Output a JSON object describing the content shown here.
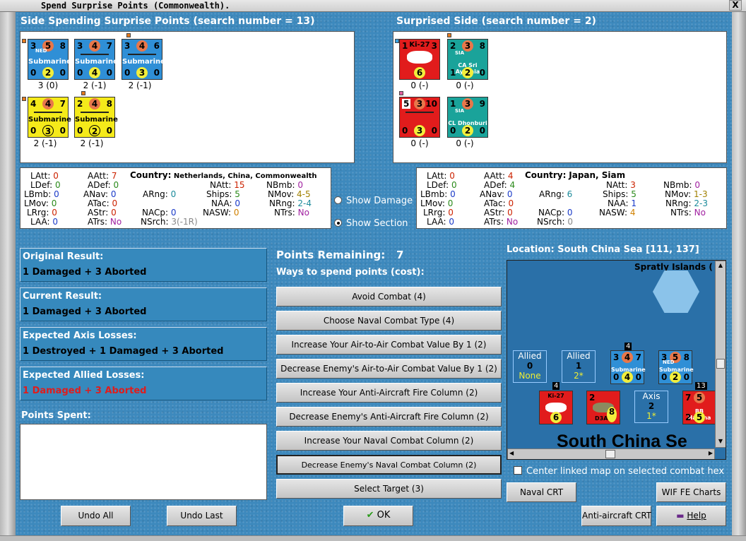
{
  "window": {
    "title": "Spend Surprise Points (Commonwealth).",
    "close": "X"
  },
  "left_side": {
    "header": "Side Spending Surprise Points (search number = 13)",
    "counters": [
      {
        "tl": "3",
        "tm": "5",
        "tr": "8",
        "nat": "NED",
        "name": "Submarine",
        "bl": "0",
        "bm": "2",
        "br": "0",
        "cap": "3 (0)"
      },
      {
        "tl": "3",
        "tm": "4",
        "tr": "7",
        "nat": "",
        "name": "Submarine",
        "bl": "0",
        "bm": "4",
        "br": "0",
        "cap": "2 (-1)"
      },
      {
        "tl": "3",
        "tm": "4",
        "tr": "6",
        "nat": "",
        "name": "Submarine",
        "bl": "0",
        "bm": "3",
        "br": "0",
        "cap": "2 (-1)"
      },
      {
        "tl": "4",
        "tm": "4",
        "tr": "7",
        "nat": "",
        "name": "Submarine",
        "bl": "0",
        "bm": "3",
        "br": "0",
        "cap": "2 (-1)"
      },
      {
        "tl": "2",
        "tm": "4",
        "tr": "8",
        "nat": "",
        "name": "Submarine",
        "bl": "0",
        "bm": "2",
        "br": "0",
        "cap": "2 (-1)"
      }
    ],
    "stats": {
      "LAtt": "0",
      "LDef": "0",
      "LBmb": "0",
      "LMov": "0",
      "LRrg": "0",
      "LAA": "0",
      "AAtt": "7",
      "ADef": "0",
      "ANav": "0",
      "ATac": "0",
      "AStr": "0",
      "ATrs": "No",
      "country_label": "Country:",
      "country": "Netherlands, China, Commonwealth",
      "ARng": "0",
      "NACp": "0",
      "NSrch": "3(-1R)",
      "NAtt": "15",
      "Ships": "5",
      "NAA": "0",
      "NASW": "0",
      "NBmb": "0",
      "NMov": "4-5",
      "NRng": "2-4",
      "NTrs": "No"
    }
  },
  "right_side": {
    "header": "Surprised Side (search number = 2)",
    "counters": [
      {
        "tl": "1",
        "tm": "",
        "tr": "3",
        "nat": "",
        "name": "Ki-27",
        "bl": "",
        "bm": "6",
        "br": "",
        "cap": "0 (-)"
      },
      {
        "tl": "2",
        "tm": "3",
        "tr": "8",
        "nat": "SIA",
        "name": "CA Sri Ayuthia",
        "bl": "1",
        "bm": "2",
        "br": "0",
        "cap": "0 (-)"
      },
      {
        "tl": "5",
        "tm": "3",
        "tr": "10",
        "nat": "",
        "name": "",
        "bl": "0",
        "bm": "3",
        "br": "0",
        "cap": "0 (-)"
      },
      {
        "tl": "1",
        "tm": "3",
        "tr": "9",
        "nat": "SIA",
        "name": "CL Dhonburi",
        "bl": "0",
        "bm": "2",
        "br": "0",
        "cap": "0 (-)"
      }
    ],
    "stats": {
      "LAtt": "0",
      "LDef": "0",
      "LBmb": "0",
      "LMov": "0",
      "LRrg": "0",
      "LAA": "0",
      "AAtt": "4",
      "ADef": "4",
      "ANav": "0",
      "ATac": "0",
      "AStr": "0",
      "ATrs": "No",
      "country_label": "Country:",
      "country": "Japan, Siam",
      "ARng": "6",
      "NACp": "0",
      "NSrch": "0",
      "NAtt": "3",
      "Ships": "5",
      "NAA": "1",
      "NASW": "4",
      "NBmb": "0",
      "NMov": "1-3",
      "NRng": "2-3",
      "NTrs": "No"
    }
  },
  "labels": {
    "LAtt": "LAtt:",
    "LDef": "LDef:",
    "LBmb": "LBmb:",
    "LMov": "LMov:",
    "LRrg": "LRrg:",
    "LAA": "LAA:",
    "AAtt": "AAtt:",
    "ADef": "ADef:",
    "ANav": "ANav:",
    "ATac": "ATac:",
    "AStr": "AStr:",
    "ATrs": "ATrs:",
    "ARng": "ARng:",
    "NACp": "NACp:",
    "NSrch": "NSrch:",
    "NAtt": "NAtt:",
    "Ships": "Ships:",
    "NAA": "NAA:",
    "NASW": "NASW:",
    "NBmb": "NBmb:",
    "NMov": "NMov:",
    "NRng": "NRng:",
    "NTrs": "NTrs:"
  },
  "radio": {
    "show_damage": "Show Damage",
    "show_section": "Show Section",
    "selected": "show_section"
  },
  "results": {
    "original": {
      "label": "Original Result:",
      "value": "1 Damaged + 3 Aborted"
    },
    "current": {
      "label": "Current Result:",
      "value": "1 Damaged + 3 Aborted"
    },
    "axis": {
      "label": "Expected Axis Losses:",
      "value": "1 Destroyed + 1 Damaged + 3 Aborted"
    },
    "allied": {
      "label": "Expected Allied Losses:",
      "value": "1 Damaged + 3 Aborted"
    }
  },
  "points_spent": {
    "label": "Points Spent:"
  },
  "points_remaining": {
    "label": "Points Remaining:",
    "value": "7"
  },
  "ways_label": "Ways to spend points (cost):",
  "spend_options": [
    "Avoid Combat (4)",
    "Choose Naval Combat Type (4)",
    "Increase Your Air-to-Air Combat Value By 1 (2)",
    "Decrease Enemy's Air-to-Air Combat Value By 1 (2)",
    "Increase Your Anti-Aircraft Fire Column (2)",
    "Decrease Enemy's Anti-Aircraft Fire Column (2)",
    "Increase Your Naval Combat Column (2)",
    "Decrease Enemy's Naval Combat Column (2)",
    "Select Target (3)"
  ],
  "location": "Location: South China Sea [111, 137]",
  "map": {
    "island": "Spratly Islands (",
    "sea": "South China Se",
    "allied_boxes": [
      {
        "t": "Allied",
        "n": "0",
        "s": "None"
      },
      {
        "t": "Allied",
        "n": "1",
        "s": "2*"
      }
    ],
    "axis_box": {
      "t": "Axis",
      "n": "2",
      "s": "1*"
    },
    "stack_counts": [
      "4",
      "4",
      "13"
    ],
    "units": {
      "u1": {
        "tl": "3",
        "tm": "4",
        "tr": "7",
        "name": "Submarine",
        "bl": "0",
        "bm": "4",
        "br": "0"
      },
      "u2": {
        "tl": "3",
        "tm": "5",
        "tr": "8",
        "nat": "NED",
        "name": "Submarine",
        "bl": "0",
        "bm": "2",
        "br": "0"
      },
      "u3": {
        "name": "Ki-27",
        "bm": "6"
      },
      "u4": {
        "tl": "2",
        "br": "8",
        "name": "D3A1"
      },
      "u5": {
        "tl": "7",
        "tm": "5",
        "name": "BB Haruna",
        "bl": "2",
        "bm": "5"
      }
    }
  },
  "center_map_label": "Center linked map on selected combat hex",
  "buttons": {
    "naval_crt": "Naval CRT",
    "wif_charts": "WIF FE Charts",
    "aa_crt": "Anti-aircraft CRT",
    "help": "Help",
    "undo_all": "Undo All",
    "undo_last": "Undo Last",
    "ok": "OK"
  },
  "colors": {
    "background": "#3d89bd",
    "allied_loss_text": "#e01c1c",
    "blue_counter": "#2f8fd6",
    "yellow_counter": "#f5ea1a",
    "red_counter": "#e11c1c",
    "teal_counter": "#1aa39a"
  }
}
